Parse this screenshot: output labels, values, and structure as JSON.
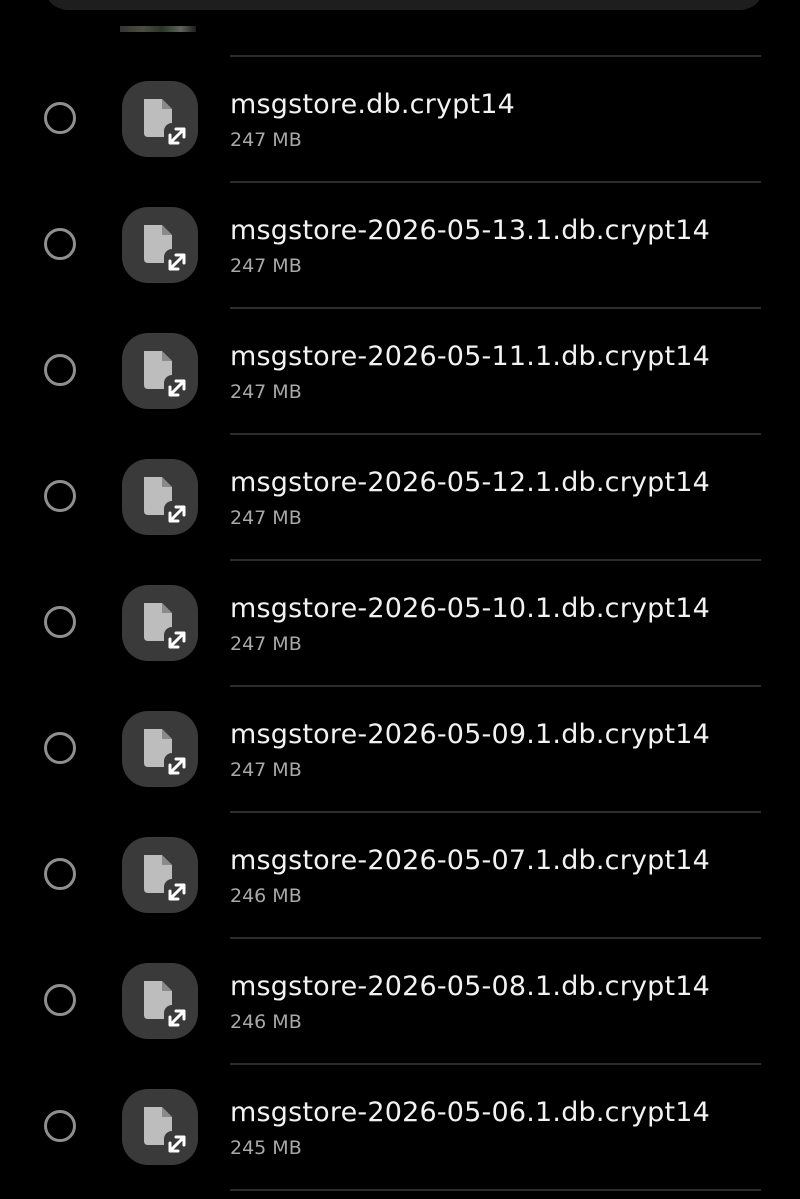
{
  "colors": {
    "background": "#000000",
    "divider": "#2c2c2c",
    "icon_bg": "#3a3a3a",
    "file_name": "#f2f2f2",
    "file_size": "#a8a8a8",
    "radio_border": "#8f8f8f"
  },
  "files": [
    {
      "name": "msgstore.db.crypt14",
      "size": "247 MB",
      "icon": "file-shortcut-icon",
      "selected": false
    },
    {
      "name": "msgstore-2026-05-13.1.db.crypt14",
      "size": "247 MB",
      "icon": "file-shortcut-icon",
      "selected": false
    },
    {
      "name": "msgstore-2026-05-11.1.db.crypt14",
      "size": "247 MB",
      "icon": "file-shortcut-icon",
      "selected": false
    },
    {
      "name": "msgstore-2026-05-12.1.db.crypt14",
      "size": "247 MB",
      "icon": "file-shortcut-icon",
      "selected": false
    },
    {
      "name": "msgstore-2026-05-10.1.db.crypt14",
      "size": "247 MB",
      "icon": "file-shortcut-icon",
      "selected": false
    },
    {
      "name": "msgstore-2026-05-09.1.db.crypt14",
      "size": "247 MB",
      "icon": "file-shortcut-icon",
      "selected": false
    },
    {
      "name": "msgstore-2026-05-07.1.db.crypt14",
      "size": "246 MB",
      "icon": "file-shortcut-icon",
      "selected": false
    },
    {
      "name": "msgstore-2026-05-08.1.db.crypt14",
      "size": "246 MB",
      "icon": "file-shortcut-icon",
      "selected": false
    },
    {
      "name": "msgstore-2026-05-06.1.db.crypt14",
      "size": "245 MB",
      "icon": "file-shortcut-icon",
      "selected": false
    }
  ]
}
